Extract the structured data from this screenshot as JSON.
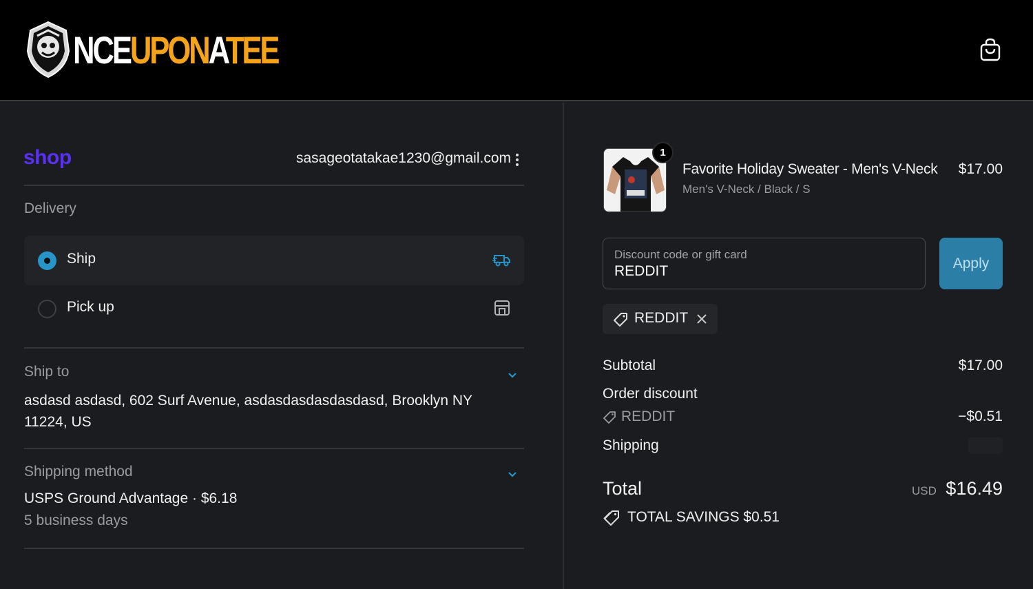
{
  "header": {
    "logo_letters_white": "NCE",
    "logo_letters_orange": "UPON",
    "logo_letters_white2": "A",
    "logo_letters_orange2": "TEE",
    "cart_icon": "shopping-bag-icon"
  },
  "account": {
    "shop_logo": "shop",
    "email": "sasageotatakae1230@gmail.com",
    "menu_icon": "kebab-icon"
  },
  "delivery": {
    "label": "Delivery",
    "options": [
      {
        "label": "Ship",
        "selected": true,
        "icon": "truck-icon"
      },
      {
        "label": "Pick up",
        "selected": false,
        "icon": "store-icon"
      }
    ]
  },
  "ship_to": {
    "label": "Ship to",
    "address": "asdasd asdasd, 602 Surf Avenue, asdasdasdasdasdasd, Brooklyn NY 11224, US"
  },
  "shipping_method": {
    "label": "Shipping method",
    "method": "USPS Ground Advantage · $6.18",
    "duration": "5 business days"
  },
  "cart": {
    "item": {
      "quantity": "1",
      "name": "Favorite Holiday Sweater - Men's V-Neck",
      "variant": "Men's V-Neck / Black / S",
      "price": "$17.00"
    },
    "discount_field": {
      "placeholder": "Discount code or gift card",
      "value": "REDDIT"
    },
    "apply_label": "Apply",
    "applied_code": "REDDIT"
  },
  "summary": {
    "subtotal_label": "Subtotal",
    "subtotal_value": "$17.00",
    "order_discount_label": "Order discount",
    "discount_code": "REDDIT",
    "discount_value": "−$0.51",
    "shipping_label": "Shipping",
    "total_label": "Total",
    "currency": "USD",
    "total_value": "$16.49",
    "savings_label": "TOTAL SAVINGS  $0.51"
  },
  "colors": {
    "accent": "#2795c7",
    "apply_button": "#2b7fa6",
    "shop_brand": "#5a31f4",
    "logo_orange": "#f5a31a"
  }
}
